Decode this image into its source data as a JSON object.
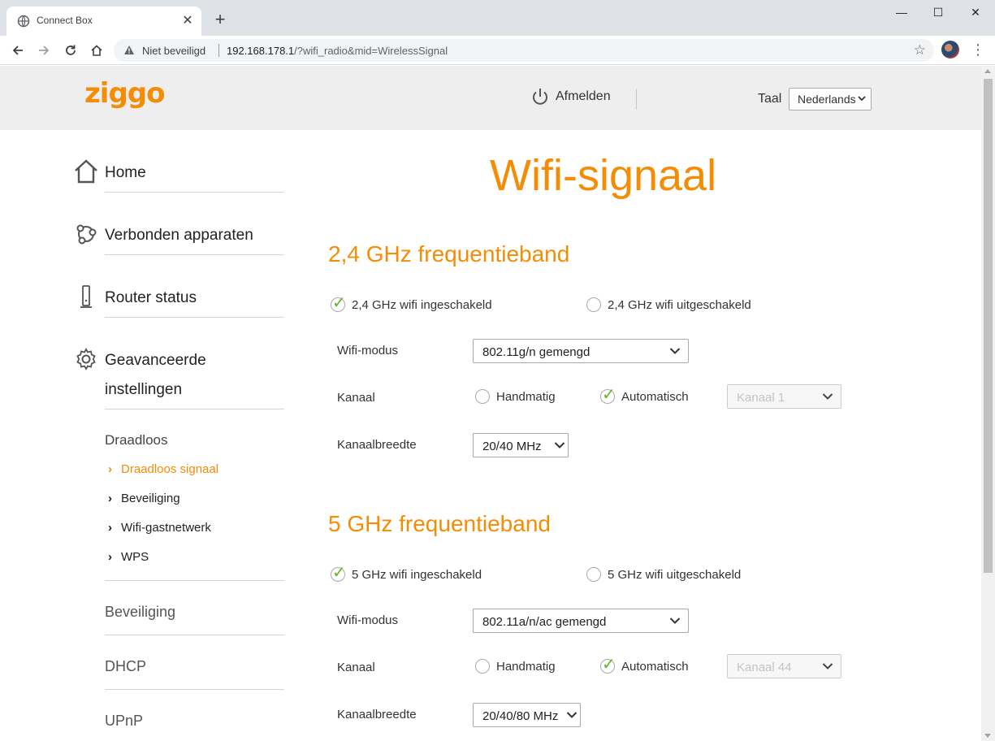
{
  "browser": {
    "tab_title": "Connect Box",
    "new_tab": "+",
    "security_text": "Niet beveiligd",
    "url_host": "192.168.178.1",
    "url_path": "/?wifi_radio&mid=WirelessSignal",
    "minimize": "—",
    "maximize": "☐",
    "close": "✕"
  },
  "header": {
    "logo": "ziggo",
    "logout": "Afmelden",
    "language_label": "Taal",
    "language_value": "Nederlands"
  },
  "sidebar": {
    "home": "Home",
    "devices": "Verbonden apparaten",
    "router_status": "Router status",
    "advanced_line1": "Geavanceerde",
    "advanced_line2": "instellingen",
    "wireless": "Draadloos",
    "sub_items": [
      "Draadloos signaal",
      "Beveiliging",
      "Wifi-gastnetwerk",
      "WPS"
    ],
    "security": "Beveiliging",
    "dhcp": "DHCP",
    "upnp": "UPnP"
  },
  "main": {
    "title": "Wifi-signaal",
    "band24": {
      "title": "2,4 GHz frequentieband",
      "enabled_label": "2,4 GHz wifi ingeschakeld",
      "disabled_label": "2,4 GHz wifi uitgeschakeld",
      "mode_label": "Wifi-modus",
      "mode_value": "802.11g/n gemengd",
      "channel_label": "Kanaal",
      "manual": "Handmatig",
      "auto": "Automatisch",
      "channel_value": "Kanaal 1",
      "width_label": "Kanaalbreedte",
      "width_value": "20/40 MHz"
    },
    "band5": {
      "title": "5 GHz frequentieband",
      "enabled_label": "5 GHz wifi ingeschakeld",
      "disabled_label": "5 GHz wifi uitgeschakeld",
      "mode_label": "Wifi-modus",
      "mode_value": "802.11a/n/ac gemengd",
      "channel_label": "Kanaal",
      "manual": "Handmatig",
      "auto": "Automatisch",
      "channel_value": "Kanaal 44",
      "width_label": "Kanaalbreedte",
      "width_value": "20/40/80 MHz"
    }
  },
  "colors": {
    "accent": "#f48c06",
    "check": "#5cb82b",
    "header_bg": "#eeeeee"
  }
}
